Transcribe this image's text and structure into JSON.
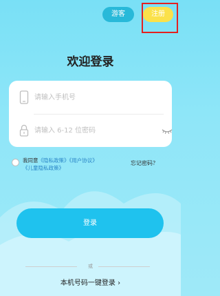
{
  "top_bar": {
    "guest_label": "游客",
    "register_label": "注册"
  },
  "title": "欢迎登录",
  "form": {
    "phone_placeholder": "请输入手机号",
    "password_placeholder": "请输入 6-12 位密码"
  },
  "agreement": {
    "prefix": "我同意",
    "privacy_policy": "《隐私政策》",
    "user_agreement": "《用户协议》",
    "child_privacy_policy": "《儿童隐私政策》",
    "checked": false
  },
  "forgot_password_label": "忘记密码？",
  "login_button_label": "登录",
  "divider_text": "或",
  "one_key_login_label": "本机号码一键登录",
  "one_key_chevron": "›",
  "colors": {
    "background": "#8fe6f8",
    "guest_button": "#28b9d9",
    "register_button": "#fbe14a",
    "login_button": "#1fc2ee",
    "link": "#2a86c7",
    "highlight": "#e41f1f"
  },
  "icons": [
    "mobile-phone-icon",
    "lock-icon",
    "eye-closed-icon",
    "chevron-right-icon"
  ]
}
